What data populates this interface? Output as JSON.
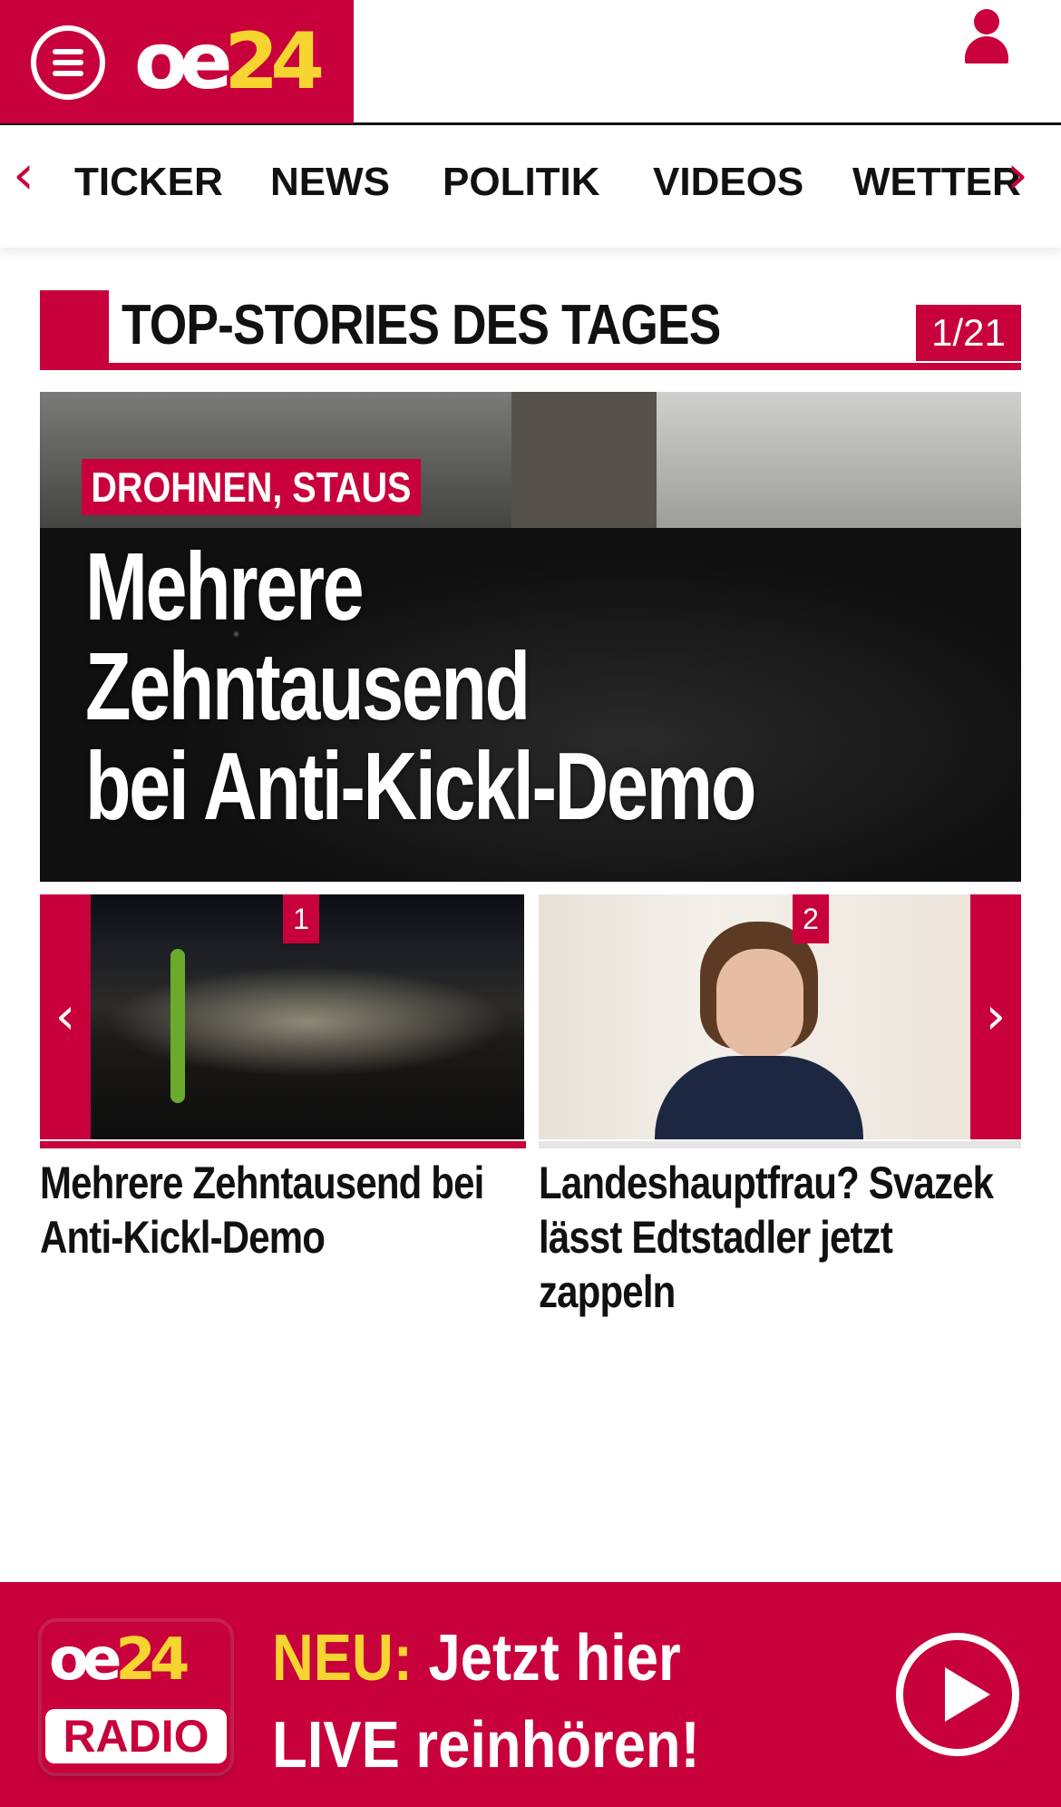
{
  "header": {
    "logo_oe": "oe",
    "logo_num": "24"
  },
  "nav": {
    "items": [
      "TICKER",
      "NEWS",
      "POLITIK",
      "VIDEOS",
      "WETTER"
    ],
    "prev_arrow": "‹",
    "next_arrow": "›"
  },
  "section": {
    "title": "TOP-STORIES DES TAGES",
    "counter": "1/21"
  },
  "hero": {
    "kicker": "DROHNEN, STAUS",
    "headline_lines": [
      "Mehrere",
      "Zehntausend",
      "bei Anti-Kickl-Demo"
    ]
  },
  "thumbs": {
    "prev_arrow": "‹",
    "next_arrow": "›",
    "items": [
      {
        "num": "1",
        "title": "Mehrere Zehntausend bei Anti-Kickl-Demo"
      },
      {
        "num": "2",
        "title": "Landeshauptfrau? Svazek lässt Edtstadler jetzt zappeln"
      }
    ]
  },
  "radio": {
    "logo_oe": "oe",
    "logo_num": "24",
    "logo_label": "RADIO",
    "neu": "NEU:",
    "line1": " Jetzt hier",
    "line2": "LIVE reinhören!"
  },
  "colors": {
    "brand_red": "#c8003c",
    "brand_yellow": "#f6d531"
  }
}
